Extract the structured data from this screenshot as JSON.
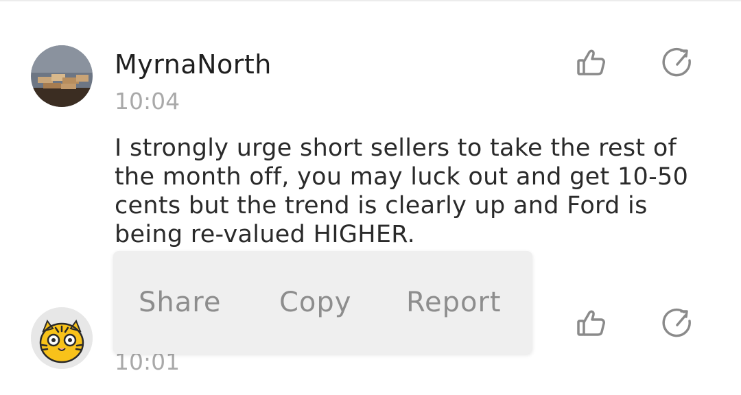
{
  "comments": [
    {
      "username": "MyrnaNorth",
      "time": "10:04",
      "text": "I strongly urge short sellers to take the rest of the month off, you may luck out and get 10-50 cents but the trend is clearly up and Ford is being re-valued HIGHER.",
      "avatar_icon": "wood-blocks-photo",
      "like_icon": "thumbs-up-icon",
      "reply_icon": "reply-icon"
    },
    {
      "username": "",
      "time": "10:01",
      "avatar_icon": "tiger-avatar",
      "like_icon": "thumbs-up-icon",
      "reply_icon": "reply-icon"
    }
  ],
  "context_menu": {
    "items": [
      "Share",
      "Copy",
      "Report"
    ]
  },
  "colors": {
    "text": "#2a2a2a",
    "muted": "#a9a9a9",
    "menu_bg": "#efefef",
    "menu_text": "#8d8d8d",
    "tiger_yellow": "#f8c21a"
  }
}
